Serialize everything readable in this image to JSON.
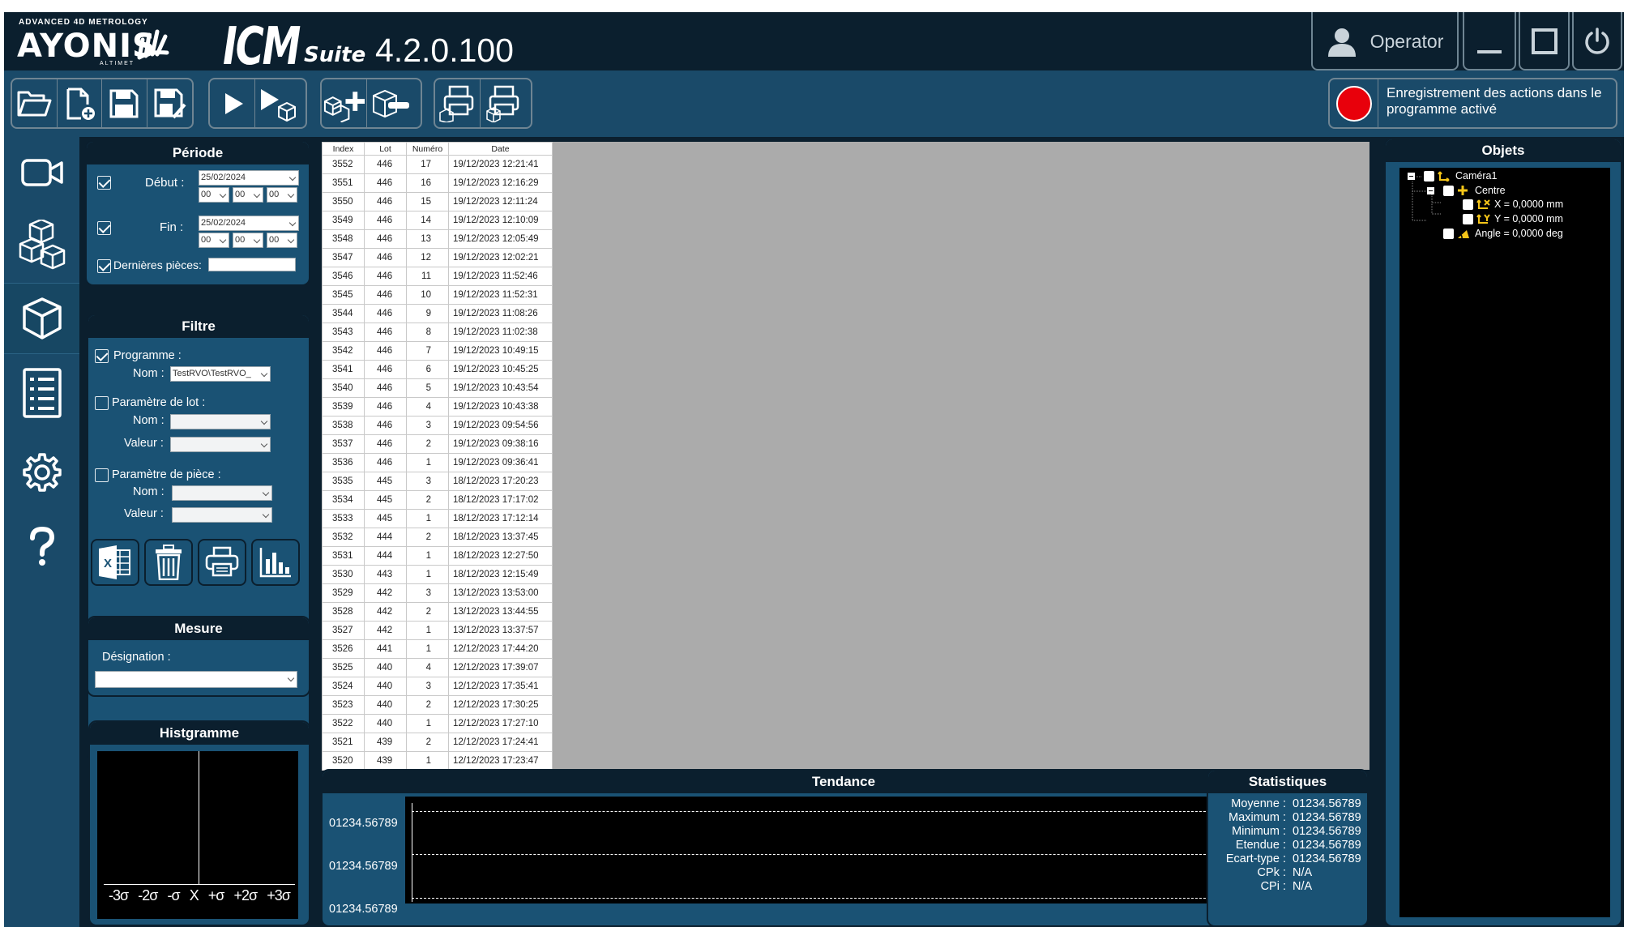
{
  "header": {
    "brand_top": "ADVANCED 4D METROLOGY",
    "brand_name": "AYONIS",
    "brand_sub": "ALTIMET",
    "product": "ICM",
    "product_suffix": "Suite",
    "version": "4.2.0.100",
    "operator_label": "Operator"
  },
  "toolbar": {
    "groups": [
      [
        "open-folder-icon",
        "new-file-icon",
        "save-icon",
        "save-as-icon"
      ],
      [
        "play-icon",
        "play-cubes-icon"
      ],
      [
        "add-object-icon",
        "remove-object-icon"
      ],
      [
        "print-icon",
        "print-report-icon"
      ]
    ],
    "record_text": "Enregistrement des actions dans le programme activé",
    "record_color": "#e8000b"
  },
  "nav": {
    "items": [
      "camera-icon",
      "cubes-icon",
      "cube-icon",
      "list-icon",
      "settings-icon",
      "help-icon"
    ],
    "active": "cube-icon"
  },
  "periode": {
    "title": "Période",
    "debut_label": "Début :",
    "debut_date": "25/02/2024",
    "debut_h": "00",
    "debut_m": "00",
    "debut_s": "00",
    "fin_label": "Fin :",
    "fin_date": "25/02/2024",
    "fin_h": "00",
    "fin_m": "00",
    "fin_s": "00",
    "dernieres_label": "Dernières pièces:",
    "dernieres_value": ""
  },
  "filtre": {
    "title": "Filtre",
    "programme_label": "Programme :",
    "nom_label": "Nom :",
    "programme_nom": "TestRVO\\TestRVO_",
    "lot_label": "Paramètre de lot :",
    "lot_nom_label": "Nom :",
    "lot_valeur_label": "Valeur :",
    "piece_label": "Paramètre de pièce :",
    "piece_nom_label": "Nom :",
    "piece_valeur_label": "Valeur :",
    "buttons": [
      "excel-icon",
      "trash-icon",
      "print-icon",
      "bar-chart-icon"
    ]
  },
  "mesure": {
    "title": "Mesure",
    "designation_label": "Désignation :",
    "designation_value": ""
  },
  "histogramme": {
    "title": "Histgramme",
    "ticks": [
      "-3σ",
      "-2σ",
      "-σ",
      "X",
      "+σ",
      "+2σ",
      "+3σ"
    ]
  },
  "table": {
    "columns": [
      "Index",
      "Lot",
      "Numéro",
      "Date"
    ],
    "rows": [
      [
        "3552",
        "446",
        "17",
        "19/12/2023 12:21:41"
      ],
      [
        "3551",
        "446",
        "16",
        "19/12/2023 12:16:29"
      ],
      [
        "3550",
        "446",
        "15",
        "19/12/2023 12:11:24"
      ],
      [
        "3549",
        "446",
        "14",
        "19/12/2023 12:10:09"
      ],
      [
        "3548",
        "446",
        "13",
        "19/12/2023 12:05:49"
      ],
      [
        "3547",
        "446",
        "12",
        "19/12/2023 12:02:21"
      ],
      [
        "3546",
        "446",
        "11",
        "19/12/2023 11:52:46"
      ],
      [
        "3545",
        "446",
        "10",
        "19/12/2023 11:52:31"
      ],
      [
        "3544",
        "446",
        "9",
        "19/12/2023 11:08:26"
      ],
      [
        "3543",
        "446",
        "8",
        "19/12/2023 11:02:38"
      ],
      [
        "3542",
        "446",
        "7",
        "19/12/2023 10:49:15"
      ],
      [
        "3541",
        "446",
        "6",
        "19/12/2023 10:45:25"
      ],
      [
        "3540",
        "446",
        "5",
        "19/12/2023 10:43:54"
      ],
      [
        "3539",
        "446",
        "4",
        "19/12/2023 10:43:38"
      ],
      [
        "3538",
        "446",
        "3",
        "19/12/2023 09:54:56"
      ],
      [
        "3537",
        "446",
        "2",
        "19/12/2023 09:38:16"
      ],
      [
        "3536",
        "446",
        "1",
        "19/12/2023 09:36:41"
      ],
      [
        "3535",
        "445",
        "3",
        "18/12/2023 17:20:23"
      ],
      [
        "3534",
        "445",
        "2",
        "18/12/2023 17:17:02"
      ],
      [
        "3533",
        "445",
        "1",
        "18/12/2023 17:12:14"
      ],
      [
        "3532",
        "444",
        "2",
        "18/12/2023 13:37:45"
      ],
      [
        "3531",
        "444",
        "1",
        "18/12/2023 12:27:50"
      ],
      [
        "3530",
        "443",
        "1",
        "18/12/2023 12:15:49"
      ],
      [
        "3529",
        "442",
        "3",
        "13/12/2023 13:53:00"
      ],
      [
        "3528",
        "442",
        "2",
        "13/12/2023 13:44:55"
      ],
      [
        "3527",
        "442",
        "1",
        "13/12/2023 13:37:57"
      ],
      [
        "3526",
        "441",
        "1",
        "12/12/2023 17:44:20"
      ],
      [
        "3525",
        "440",
        "4",
        "12/12/2023 17:39:07"
      ],
      [
        "3524",
        "440",
        "3",
        "12/12/2023 17:35:41"
      ],
      [
        "3523",
        "440",
        "2",
        "12/12/2023 17:30:25"
      ],
      [
        "3522",
        "440",
        "1",
        "12/12/2023 17:27:10"
      ],
      [
        "3521",
        "439",
        "2",
        "12/12/2023 17:24:41"
      ],
      [
        "3520",
        "439",
        "1",
        "12/12/2023 17:23:47"
      ]
    ]
  },
  "tendance": {
    "title": "Tendance",
    "y_labels": [
      "01234.56789",
      "01234.56789",
      "01234.56789"
    ]
  },
  "statistiques": {
    "title": "Statistiques",
    "rows": [
      [
        "Moyenne :",
        "01234.56789"
      ],
      [
        "Maximum :",
        "01234.56789"
      ],
      [
        "Minimum :",
        "01234.56789"
      ],
      [
        "Etendue :",
        "01234.56789"
      ],
      [
        "Ecart-type :",
        "01234.56789"
      ],
      [
        "CPk :",
        "N/A"
      ],
      [
        "CPi :",
        "N/A"
      ]
    ]
  },
  "objets": {
    "title": "Objets",
    "tree": [
      "Caméra1",
      "Centre",
      "X = 0,0000 mm",
      "Y = 0,0000 mm",
      "Angle = 0,0000 deg"
    ]
  }
}
